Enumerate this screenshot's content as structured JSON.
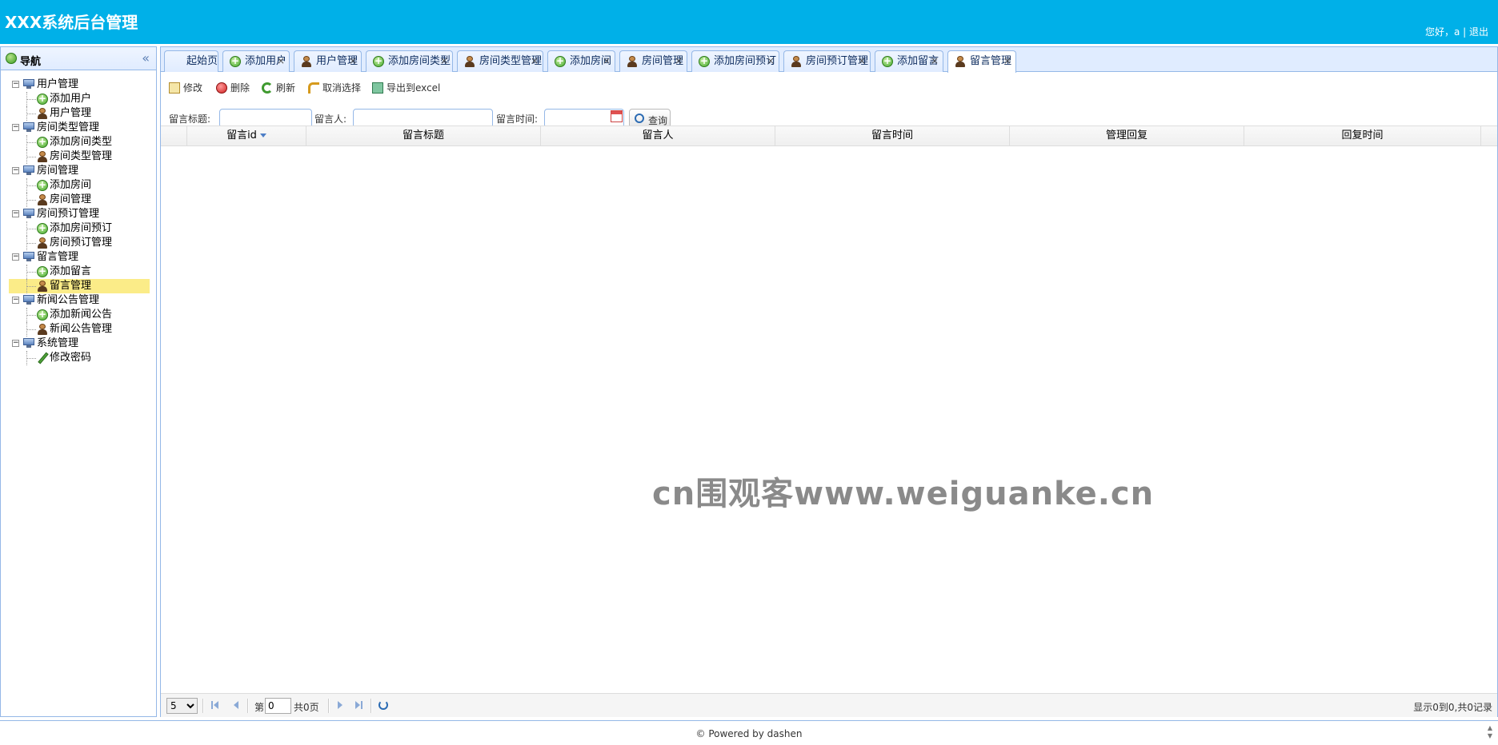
{
  "header": {
    "title": "XXX系统后台管理",
    "greeting": "您好，a",
    "separator": " | ",
    "logout": "退出",
    "bg_color": "#00b0e8"
  },
  "sidebar": {
    "title": "导航",
    "collapse_icon": "«",
    "groups": [
      {
        "label": "用户管理",
        "children": [
          {
            "label": "添加用户",
            "icon": "add-icon"
          },
          {
            "label": "用户管理",
            "icon": "user-icon"
          }
        ]
      },
      {
        "label": "房间类型管理",
        "children": [
          {
            "label": "添加房间类型",
            "icon": "add-icon"
          },
          {
            "label": "房间类型管理",
            "icon": "user-icon"
          }
        ]
      },
      {
        "label": "房间管理",
        "children": [
          {
            "label": "添加房间",
            "icon": "add-icon"
          },
          {
            "label": "房间管理",
            "icon": "user-icon"
          }
        ]
      },
      {
        "label": "房间预订管理",
        "children": [
          {
            "label": "添加房间预订",
            "icon": "add-icon"
          },
          {
            "label": "房间预订管理",
            "icon": "user-icon"
          }
        ]
      },
      {
        "label": "留言管理",
        "children": [
          {
            "label": "添加留言",
            "icon": "add-icon"
          },
          {
            "label": "留言管理",
            "icon": "user-icon",
            "selected": true
          }
        ]
      },
      {
        "label": "新闻公告管理",
        "children": [
          {
            "label": "添加新闻公告",
            "icon": "add-icon"
          },
          {
            "label": "新闻公告管理",
            "icon": "user-icon"
          }
        ]
      },
      {
        "label": "系统管理",
        "children": [
          {
            "label": "修改密码",
            "icon": "pencil-icon"
          }
        ]
      }
    ]
  },
  "tabs": [
    {
      "label": "起始页",
      "icon": "none",
      "closable": false
    },
    {
      "label": "添加用户",
      "icon": "add-icon",
      "closable": true
    },
    {
      "label": "用户管理",
      "icon": "user-icon",
      "closable": true
    },
    {
      "label": "添加房间类型",
      "icon": "add-icon",
      "closable": true
    },
    {
      "label": "房间类型管理",
      "icon": "user-icon",
      "closable": true
    },
    {
      "label": "添加房间",
      "icon": "add-icon",
      "closable": true
    },
    {
      "label": "房间管理",
      "icon": "user-icon",
      "closable": true
    },
    {
      "label": "添加房间预订",
      "icon": "add-icon",
      "closable": true
    },
    {
      "label": "房间预订管理",
      "icon": "user-icon",
      "closable": true
    },
    {
      "label": "添加留言",
      "icon": "add-icon",
      "closable": true
    },
    {
      "label": "留言管理",
      "icon": "user-icon",
      "closable": true,
      "active": true
    }
  ],
  "toolbar": {
    "edit": "修改",
    "delete": "删除",
    "refresh": "刷新",
    "unselect": "取消选择",
    "export": "导出到excel"
  },
  "search": {
    "title_label": "留言标题:",
    "title_value": "",
    "author_label": "留言人:",
    "author_value": "",
    "time_label": "留言时间:",
    "time_value": "",
    "query_label": "查询"
  },
  "grid": {
    "columns": [
      "留言id",
      "留言标题",
      "留言人",
      "留言时间",
      "管理回复",
      "回复时间"
    ],
    "sort_column": "留言id",
    "rows": []
  },
  "watermark": "cn围观客www.weiguanke.cn",
  "pager": {
    "page_size": "5",
    "page_size_options": [
      "5",
      "10",
      "15",
      "20"
    ],
    "page_prefix": "第",
    "page_value": "0",
    "page_suffix": "共0页",
    "info": "显示0到0,共0记录"
  },
  "footer": {
    "text": "© Powered by dashen"
  }
}
